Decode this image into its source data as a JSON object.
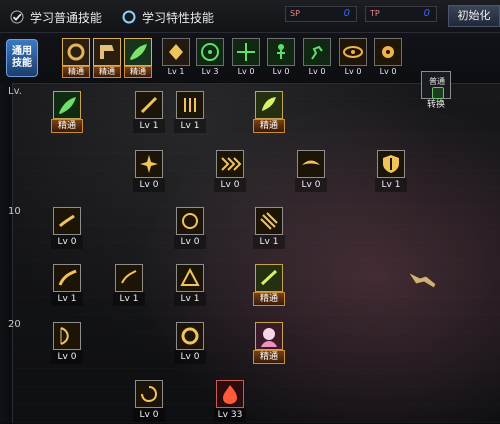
{
  "tabs": {
    "normal": "学习普通技能",
    "special": "学习特性技能"
  },
  "stats": [
    {
      "label": "SP",
      "value": "0",
      "color": "#d88"
    },
    {
      "label": "TP",
      "value": "0",
      "color": "#d88"
    }
  ],
  "reset_button": "初始化",
  "common_skills_label": [
    "通用",
    "技能"
  ],
  "common_slots": [
    {
      "caption": "精通",
      "caption_style": "master",
      "icon": "ring-icon"
    },
    {
      "caption": "精通",
      "caption_style": "master",
      "icon": "boot-icon"
    },
    {
      "caption": "精通",
      "caption_style": "master",
      "icon": "leaf-icon"
    },
    {
      "caption": "Lv 1",
      "caption_style": "",
      "icon": "wing-icon"
    },
    {
      "caption": "Lv 3",
      "caption_style": "",
      "icon": "target-icon"
    },
    {
      "caption": "Lv 0",
      "caption_style": "",
      "icon": "crosshair-icon"
    },
    {
      "caption": "Lv 0",
      "caption_style": "",
      "icon": "figure-icon"
    },
    {
      "caption": "Lv 0",
      "caption_style": "",
      "icon": "runner-icon"
    },
    {
      "caption": "Lv 0",
      "caption_style": "",
      "icon": "eye-icon"
    },
    {
      "caption": "Lv 0",
      "caption_style": "",
      "icon": "flower-icon"
    }
  ],
  "swap": {
    "top": "普通",
    "bottom": "转换"
  },
  "level_labels": [
    "Lv.",
    "10",
    "20"
  ],
  "skills": [
    {
      "caption": "精通",
      "style": "master",
      "icon": "leaf-icon"
    },
    {
      "caption": "Lv 1",
      "style": "",
      "icon": "slash-icon"
    },
    {
      "caption": "Lv 1",
      "style": "",
      "icon": "arrow-rain-icon"
    },
    {
      "caption": "精通",
      "style": "master",
      "icon": "wing-icon"
    },
    {
      "caption": "Lv 0",
      "style": "",
      "icon": "burst-icon"
    },
    {
      "caption": "Lv 0",
      "style": "",
      "icon": "chevrons-icon"
    },
    {
      "caption": "Lv 0",
      "style": "",
      "icon": "eagle-icon"
    },
    {
      "caption": "Lv 1",
      "style": "",
      "icon": "shield-icon"
    },
    {
      "caption": "Lv 0",
      "style": "",
      "icon": "kick-icon"
    },
    {
      "caption": "Lv 0",
      "style": "",
      "icon": "orb-icon"
    },
    {
      "caption": "Lv 1",
      "style": "",
      "icon": "claw-icon"
    },
    {
      "caption": "Lv 1",
      "style": "",
      "icon": "swing-icon"
    },
    {
      "caption": "Lv 1",
      "style": "",
      "icon": "arc-icon"
    },
    {
      "caption": "Lv 1",
      "style": "",
      "icon": "triangle-icon"
    },
    {
      "caption": "精通",
      "style": "master",
      "icon": "sparkle-icon"
    },
    {
      "caption": "Lv 0",
      "style": "",
      "icon": "bow-icon"
    },
    {
      "caption": "Lv 0",
      "style": "",
      "icon": "ring-icon"
    },
    {
      "caption": "精通",
      "style": "master",
      "icon": "portrait-icon"
    },
    {
      "caption": "Lv 0",
      "style": "",
      "icon": "spin-icon"
    },
    {
      "caption": "Lv 33",
      "style": "red",
      "icon": "flame-icon"
    }
  ]
}
